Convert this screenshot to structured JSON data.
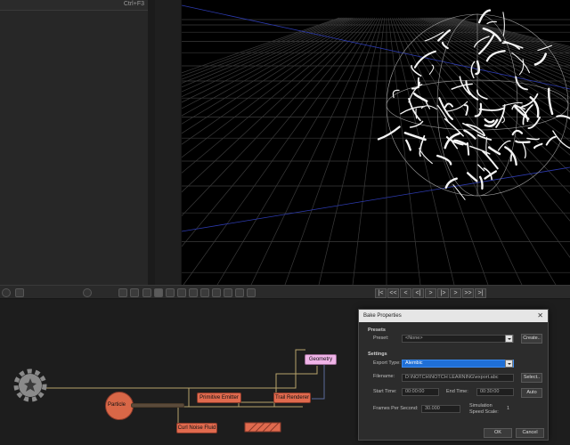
{
  "left_panel": {
    "shortcut": "Ctrl+F3"
  },
  "timeline": {
    "play_controls": [
      "|<",
      "<<",
      "<",
      "<|",
      ">",
      "|>",
      ">",
      ">>",
      ">|"
    ]
  },
  "nodes": {
    "particle": "Particle",
    "primitive_emitter": "Primitive Emitter",
    "trail_renderer": "Trail Renderer",
    "geometry": "Geometry",
    "curl_noise_fluid": "Curl Noise Fluid"
  },
  "dialog": {
    "title": "Bake Properties",
    "close": "✕",
    "presets_heading": "Presets",
    "preset_label": "Preset:",
    "preset_value": "<None>",
    "create_button": "Create..",
    "settings_heading": "Settings",
    "export_type_label": "Export Type:",
    "export_type_value": "Alembic",
    "filename_label": "Filename:",
    "filename_value": "D:\\NOTCH\\NOTCH LEARNING\\export.abc",
    "select_button": "Select..",
    "start_time_label": "Start Time:",
    "start_time_value": "00:00:00",
    "end_time_label": "End Time:",
    "end_time_value": "00:30:00",
    "auto_button": "Auto",
    "fps_label": "Frames Per Second:",
    "fps_value": "30.000",
    "sim_speed_label_1": "Simulation",
    "sim_speed_label_2": "Speed Scale:",
    "sim_speed_value": "1",
    "ok_button": "OK",
    "cancel_button": "Cancel"
  },
  "colors": {
    "node_red": "#e06a4e",
    "node_pink": "#f0b4e8",
    "selection_blue": "#1f6fd6",
    "connection_wire": "#b8a46a"
  }
}
